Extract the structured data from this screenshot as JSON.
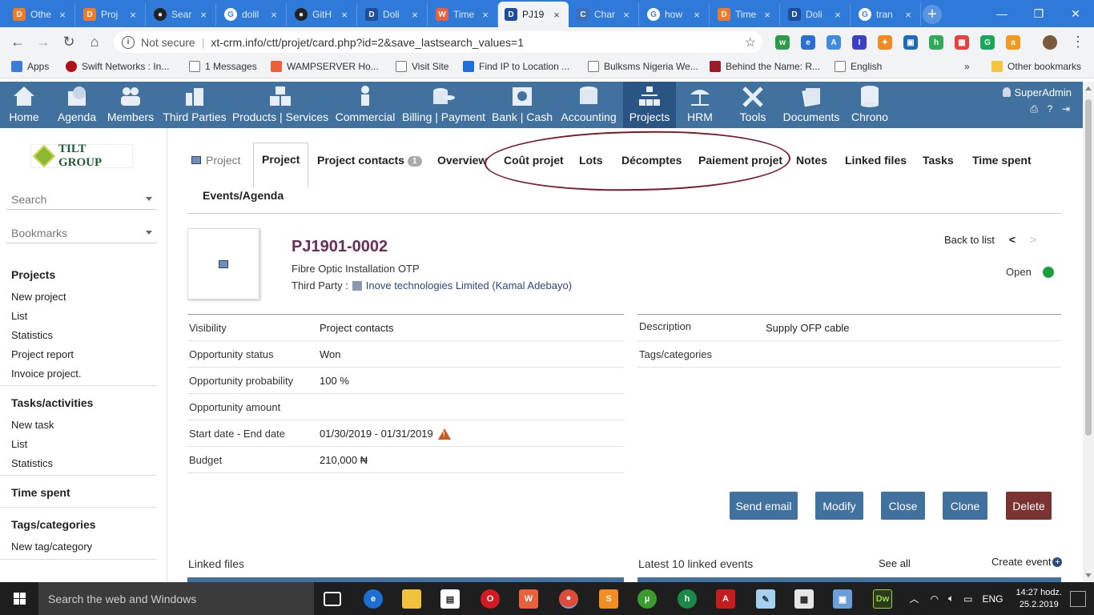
{
  "browser": {
    "tabs": [
      {
        "title": "Othe",
        "icon": "dolibarr-orange-icon"
      },
      {
        "title": "Proj",
        "icon": "dolibarr-orange-icon"
      },
      {
        "title": "Sear",
        "icon": "github-icon"
      },
      {
        "title": "dolil",
        "icon": "google-icon"
      },
      {
        "title": "GitH",
        "icon": "github-icon"
      },
      {
        "title": "Doli",
        "icon": "dolibarr-icon"
      },
      {
        "title": "Time",
        "icon": "wamp-icon"
      },
      {
        "title": "PJ19",
        "icon": "dolibarr-icon",
        "active": true
      },
      {
        "title": "Char",
        "icon": "chart-icon"
      },
      {
        "title": "how",
        "icon": "google-icon"
      },
      {
        "title": "Time",
        "icon": "dolibarr-orange-icon"
      },
      {
        "title": "Doli",
        "icon": "dolibarr-icon"
      },
      {
        "title": "tran",
        "icon": "google-icon"
      }
    ],
    "address": {
      "security": "Not secure",
      "url": "xt-crm.info/ctt/projet/card.php?id=2&save_lastsearch_values=1"
    },
    "bookmarks": [
      {
        "label": "Apps"
      },
      {
        "label": "Swift Networks : In..."
      },
      {
        "label": "1 Messages"
      },
      {
        "label": "WAMPSERVER Ho..."
      },
      {
        "label": "Visit Site"
      },
      {
        "label": "Find IP to Location ..."
      },
      {
        "label": "Bulksms Nigeria We..."
      },
      {
        "label": "Behind the Name: R..."
      },
      {
        "label": "English"
      },
      {
        "label": "»"
      },
      {
        "label": "Other bookmarks"
      }
    ]
  },
  "topmenu": {
    "items": [
      {
        "label": "Home"
      },
      {
        "label": "Agenda"
      },
      {
        "label": "Members"
      },
      {
        "label": "Third Parties"
      },
      {
        "label": "Products | Services"
      },
      {
        "label": "Commercial"
      },
      {
        "label": "Billing | Payment"
      },
      {
        "label": "Bank | Cash"
      },
      {
        "label": "Accounting"
      },
      {
        "label": "Projects",
        "selected": true
      },
      {
        "label": "HRM"
      },
      {
        "label": "Tools"
      },
      {
        "label": "Documents"
      },
      {
        "label": "Chrono"
      }
    ],
    "user": "SuperAdmin"
  },
  "sidebar": {
    "logo_text": "TILT GROUP",
    "search_placeholder": "Search",
    "bookmarks_placeholder": "Bookmarks",
    "sections": [
      {
        "title": "Projects",
        "items": [
          "New project",
          "List",
          "Statistics",
          "Project report",
          "Invoice project."
        ]
      },
      {
        "title": "Tasks/activities",
        "items": [
          "New task",
          "List",
          "Statistics"
        ]
      },
      {
        "title": "Time spent",
        "items": []
      },
      {
        "title": "Tags/categories",
        "items": [
          "New tag/category"
        ]
      }
    ]
  },
  "tabs": {
    "breadcrumb": "Project",
    "items": [
      {
        "label": "Project",
        "active": true
      },
      {
        "label": "Project contacts",
        "badge": "1"
      },
      {
        "label": "Overview"
      },
      {
        "label": "Coût projet"
      },
      {
        "label": "Lots"
      },
      {
        "label": "Décomptes"
      },
      {
        "label": "Paiement projet"
      },
      {
        "label": "Notes"
      },
      {
        "label": "Linked files"
      },
      {
        "label": "Tasks"
      },
      {
        "label": "Time spent"
      },
      {
        "label": "Events/Agenda"
      }
    ]
  },
  "project": {
    "ref": "PJ1901-0002",
    "label": "Fibre Optic Installation OTP",
    "third_party_label": "Third Party :",
    "third_party": "Inove technologies Limited (Kamal Adebayo)",
    "back_to_list": "Back to list",
    "status": "Open",
    "status_color": "#1a9f3a"
  },
  "fields_left": [
    {
      "key": "Visibility",
      "value": "Project contacts"
    },
    {
      "key": "Opportunity status",
      "value": "Won"
    },
    {
      "key": "Opportunity probability",
      "value": "100 %"
    },
    {
      "key": "Opportunity amount",
      "value": ""
    },
    {
      "key": "Start date - End date",
      "value": "01/30/2019 - 01/31/2019",
      "warning": true
    },
    {
      "key": "Budget",
      "value": "210,000 ₦"
    }
  ],
  "fields_right": [
    {
      "key": "Description",
      "value": "Supply OFP cable"
    },
    {
      "key": "Tags/categories",
      "value": ""
    }
  ],
  "actions": {
    "send_email": "Send email",
    "modify": "Modify",
    "close": "Close",
    "clone": "Clone",
    "delete": "Delete"
  },
  "bottom": {
    "linked_files": "Linked files",
    "latest_events": "Latest 10 linked events",
    "see_all": "See all",
    "create_event": "Create event"
  },
  "taskbar": {
    "search_placeholder": "Search the web and Windows",
    "language": "ENG",
    "time": "14:27 hodz.",
    "date": "25.2.2019"
  },
  "colors": {
    "menu_bg": "#41719e",
    "menu_selected": "#2a5483",
    "ref_color": "#6a2c5a",
    "delete_bg": "#7a3331",
    "annotation_circle": "#7a1a2a"
  }
}
